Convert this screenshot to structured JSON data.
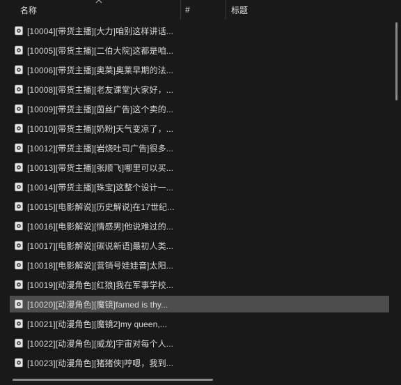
{
  "columns": {
    "name": "名称",
    "number": "#",
    "title": "标题"
  },
  "files": [
    {
      "label": "[10004][带货主播][大力]咱别这样讲话...",
      "selected": false
    },
    {
      "label": "[10005][带货主播][二伯大院]这都是咱...",
      "selected": false
    },
    {
      "label": "[10006][带货主播][奥莱]奥莱早期的法...",
      "selected": false
    },
    {
      "label": "[10008][带货主播][老友课堂]大家好，...",
      "selected": false
    },
    {
      "label": "[10009][带货主播][茵丝广告]这个卖的...",
      "selected": false
    },
    {
      "label": "[10010][带货主播][奶粉]天气变凉了，...",
      "selected": false
    },
    {
      "label": "[10012][带货主播][岩烧吐司广告]很多...",
      "selected": false
    },
    {
      "label": "[10013][带货主播][张顺飞]哪里可以买...",
      "selected": false
    },
    {
      "label": "[10014][带货主播][珠宝]这整个设计一...",
      "selected": false
    },
    {
      "label": "[10015][电影解说][历史解说]在17世纪...",
      "selected": false
    },
    {
      "label": "[10016][电影解说][情感男]他说难过的...",
      "selected": false
    },
    {
      "label": "[10017][电影解说][碳说新语]最初人类...",
      "selected": false
    },
    {
      "label": "[10018][电影解说][营销号娃娃音]太阳...",
      "selected": false
    },
    {
      "label": "[10019][动漫角色][红狼]我在军事学校...",
      "selected": false
    },
    {
      "label": "[10020][动漫角色][魔镜]famed is thy...",
      "selected": true
    },
    {
      "label": "[10021][动漫角色][魔镜2]my queen,...",
      "selected": false
    },
    {
      "label": "[10022][动漫角色][威龙]宇宙对每个人...",
      "selected": false
    },
    {
      "label": "[10023][动漫角色][猪猪侠]哼嗯，我到...",
      "selected": false
    }
  ],
  "icons": {
    "file": "audio-file-icon",
    "sort": "sort-ascending-icon"
  },
  "colors": {
    "background": "#191919",
    "selected_row": "#4d4d4d",
    "text": "#d9d9d9"
  }
}
